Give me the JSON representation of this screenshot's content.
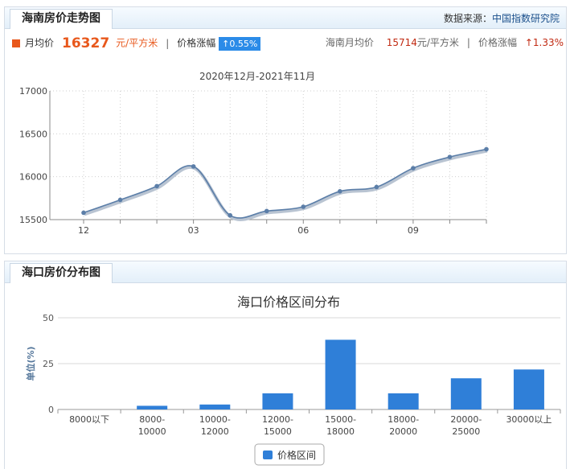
{
  "trend_panel": {
    "title": "海南房价走势图",
    "source_label": "数据来源：",
    "source_name": "中国指数研究院",
    "avg_label": "月均价",
    "avg_value": "16327",
    "avg_unit": "元/平方米",
    "change_label": "价格涨幅",
    "change_value": "↑0.55%",
    "region_avg_label": "海南月均价",
    "region_avg_value": "15714",
    "region_avg_unit": "元/平方米",
    "region_change_label": "价格涨幅",
    "region_change_value": "↑1.33%"
  },
  "dist_panel": {
    "title": "海口房价分布图"
  },
  "colors": {
    "accent": "#e8581c",
    "badge": "#2b8be8",
    "line": "#5b7ea8",
    "bar": "#2f7fd8",
    "red": "#c12a12"
  },
  "chart_data": [
    {
      "type": "line",
      "title": "2020年12月-2021年11月",
      "x": [
        "12",
        "01",
        "02",
        "03",
        "04",
        "05",
        "06",
        "07",
        "08",
        "09",
        "10",
        "11"
      ],
      "xtick_labels": [
        "12",
        "03",
        "06",
        "09"
      ],
      "values": [
        15580,
        15730,
        15890,
        16120,
        15550,
        15600,
        15650,
        15830,
        15880,
        16100,
        16230,
        16320
      ],
      "ylim": [
        15500,
        17000
      ],
      "yticks": [
        "17000",
        "16500",
        "16000",
        "15500"
      ],
      "grid": true
    },
    {
      "type": "bar",
      "title": "海口价格区间分布",
      "ylabel": "单位(%)",
      "categories": [
        [
          "8000以下"
        ],
        [
          "8000-",
          "10000"
        ],
        [
          "10000-",
          "12000"
        ],
        [
          "12000-",
          "15000"
        ],
        [
          "15000-",
          "18000"
        ],
        [
          "18000-",
          "20000"
        ],
        [
          "20000-",
          "25000"
        ],
        [
          "30000以上"
        ]
      ],
      "values": [
        0,
        2,
        2.7,
        8.8,
        38,
        8.8,
        17,
        21.8
      ],
      "ylim": [
        0,
        50
      ],
      "yticks": [
        "50",
        "25",
        "0"
      ],
      "legend": "价格区间",
      "legend_position": "bottom"
    }
  ]
}
